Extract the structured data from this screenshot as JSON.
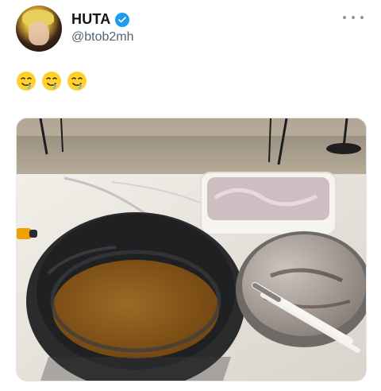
{
  "user": {
    "display_name": "HUTA",
    "handle": "@btob2mh",
    "verified_icon": "verified-badge-icon",
    "avatar_icon": "avatar"
  },
  "tweet": {
    "emojis": [
      "🤤",
      "🤤",
      "🤤"
    ]
  },
  "media": {
    "alt_icon": "photo-media",
    "colors": {
      "pot": "#2a2b2d",
      "broth": "#8d5a17",
      "counter": "#e9e4dd",
      "floor": "#a79b86"
    }
  }
}
